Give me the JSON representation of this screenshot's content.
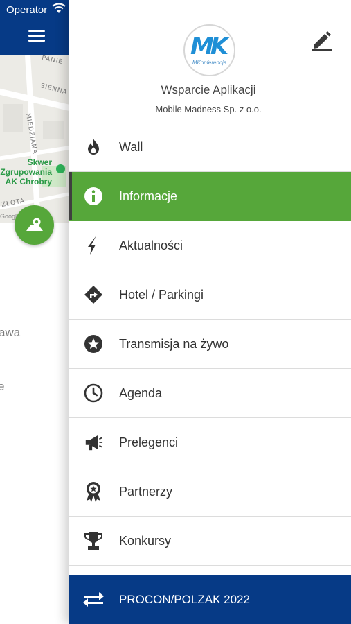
{
  "status_bar": {
    "carrier": "Operator"
  },
  "background": {
    "map": {
      "streets": [
        "SIENNA",
        "MIEDZIANA",
        "ZŁOTA",
        "PANIE"
      ],
      "poi_label": "Skwer Zgrupowania AK Chrobry",
      "attribution": "Google"
    },
    "partial_text_1": "awa",
    "partial_text_2": "e"
  },
  "drawer": {
    "profile": {
      "logo_letters": "MK",
      "logo_caption": "MKonferencja",
      "name": "Wsparcie Aplikacji",
      "company": "Mobile Madness Sp. z o.o."
    },
    "items": [
      {
        "label": "Wall",
        "icon": "flame-icon"
      },
      {
        "label": "Informacje",
        "icon": "info-icon"
      },
      {
        "label": "Aktualności",
        "icon": "bolt-icon"
      },
      {
        "label": "Hotel / Parkingi",
        "icon": "directions-icon"
      },
      {
        "label": "Transmisja na żywo",
        "icon": "star-icon"
      },
      {
        "label": "Agenda",
        "icon": "clock-icon"
      },
      {
        "label": "Prelegenci",
        "icon": "megaphone-icon"
      },
      {
        "label": "Partnerzy",
        "icon": "award-icon"
      },
      {
        "label": "Konkursy",
        "icon": "trophy-icon"
      }
    ],
    "active_item": "Informacje",
    "footer": {
      "label": "PROCON/POLZAK 2022",
      "icon": "switch-icon"
    }
  },
  "colors": {
    "primary_blue": "#063a86",
    "accent_green": "#56a73a",
    "icon_dark": "#333333"
  }
}
